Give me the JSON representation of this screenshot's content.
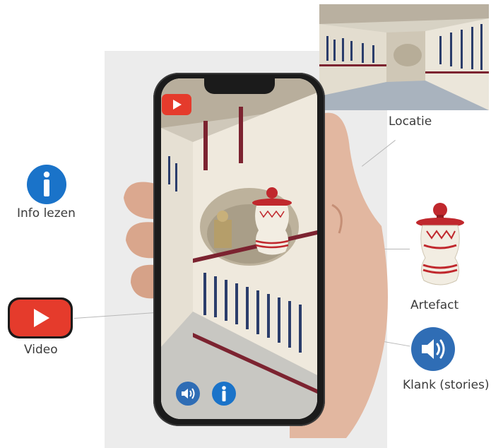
{
  "labels": {
    "location": "Locatie",
    "info": "Info lezen",
    "artefact": "Artefact",
    "video": "Video",
    "sound": "Klank (stories)"
  },
  "icons": {
    "info": "info-icon",
    "video": "video-play-icon",
    "sound": "speaker-icon",
    "artefact": "vase-artefact-icon",
    "location": "tomb-photo"
  },
  "colors": {
    "info_blue": "#1a73c9",
    "video_red": "#e53b2c",
    "sound_blue": "#2f6db5",
    "vase_red": "#c0282d",
    "vase_body": "#f2ede2"
  }
}
